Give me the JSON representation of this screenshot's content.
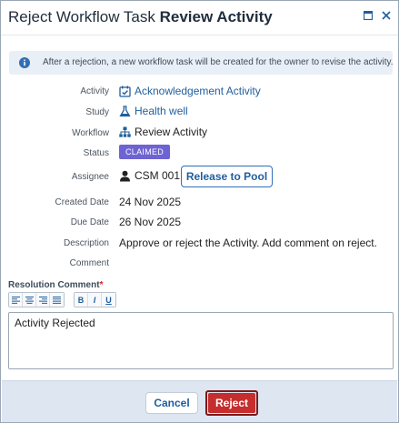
{
  "dialog": {
    "title_prefix": "Reject Workflow Task",
    "title_strong": "Review Activity"
  },
  "info": {
    "text": "After a rejection, a new workflow task will be created for the owner to revise the activity."
  },
  "fields": {
    "activity": {
      "label": "Activity",
      "value": "Acknowledgement Activity",
      "icon": "checkbox-calendar-icon"
    },
    "study": {
      "label": "Study",
      "value": "Health well",
      "icon": "flask-icon"
    },
    "workflow": {
      "label": "Workflow",
      "value": "Review Activity",
      "icon": "sitemap-icon"
    },
    "status": {
      "label": "Status",
      "value": "CLAIMED"
    },
    "assignee": {
      "label": "Assignee",
      "value": "CSM 001",
      "icon": "user-icon"
    },
    "created": {
      "label": "Created Date",
      "value": "24 Nov 2025"
    },
    "due": {
      "label": "Due Date",
      "value": "26 Nov 2025"
    },
    "description": {
      "label": "Description",
      "value": "Approve or reject the Activity. Add comment on reject."
    },
    "comment": {
      "label": "Comment",
      "value": ""
    }
  },
  "release_button": "Release to Pool",
  "resolution": {
    "label": "Resolution Comment",
    "required_mark": "*",
    "value": "Activity Rejected"
  },
  "toolbar": {
    "bold": "B",
    "italic": "I",
    "underline": "U"
  },
  "footer": {
    "cancel": "Cancel",
    "reject": "Reject"
  },
  "colors": {
    "accent": "#1f5e9e",
    "status_badge": "#6e63d2",
    "reject": "#c62e2e",
    "footer_bg": "#dde6f1"
  }
}
